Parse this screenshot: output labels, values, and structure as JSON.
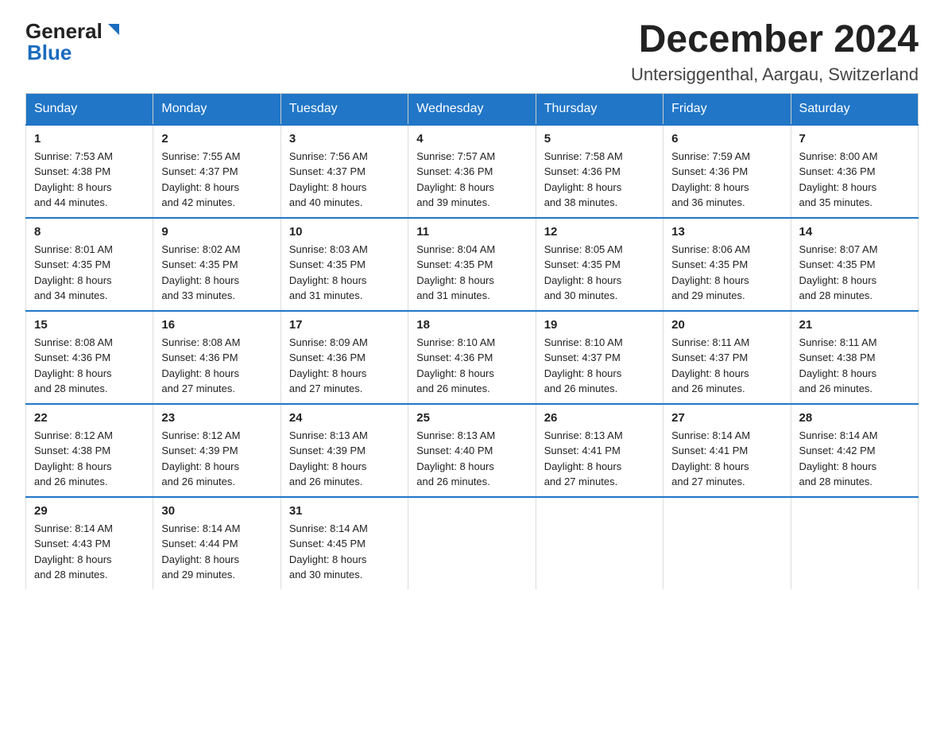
{
  "header": {
    "logo_general": "General",
    "logo_blue": "Blue",
    "title": "December 2024",
    "subtitle": "Untersiggenthal, Aargau, Switzerland"
  },
  "weekdays": [
    "Sunday",
    "Monday",
    "Tuesday",
    "Wednesday",
    "Thursday",
    "Friday",
    "Saturday"
  ],
  "weeks": [
    [
      {
        "day": "1",
        "sunrise": "Sunrise: 7:53 AM",
        "sunset": "Sunset: 4:38 PM",
        "daylight": "Daylight: 8 hours",
        "daylight2": "and 44 minutes."
      },
      {
        "day": "2",
        "sunrise": "Sunrise: 7:55 AM",
        "sunset": "Sunset: 4:37 PM",
        "daylight": "Daylight: 8 hours",
        "daylight2": "and 42 minutes."
      },
      {
        "day": "3",
        "sunrise": "Sunrise: 7:56 AM",
        "sunset": "Sunset: 4:37 PM",
        "daylight": "Daylight: 8 hours",
        "daylight2": "and 40 minutes."
      },
      {
        "day": "4",
        "sunrise": "Sunrise: 7:57 AM",
        "sunset": "Sunset: 4:36 PM",
        "daylight": "Daylight: 8 hours",
        "daylight2": "and 39 minutes."
      },
      {
        "day": "5",
        "sunrise": "Sunrise: 7:58 AM",
        "sunset": "Sunset: 4:36 PM",
        "daylight": "Daylight: 8 hours",
        "daylight2": "and 38 minutes."
      },
      {
        "day": "6",
        "sunrise": "Sunrise: 7:59 AM",
        "sunset": "Sunset: 4:36 PM",
        "daylight": "Daylight: 8 hours",
        "daylight2": "and 36 minutes."
      },
      {
        "day": "7",
        "sunrise": "Sunrise: 8:00 AM",
        "sunset": "Sunset: 4:36 PM",
        "daylight": "Daylight: 8 hours",
        "daylight2": "and 35 minutes."
      }
    ],
    [
      {
        "day": "8",
        "sunrise": "Sunrise: 8:01 AM",
        "sunset": "Sunset: 4:35 PM",
        "daylight": "Daylight: 8 hours",
        "daylight2": "and 34 minutes."
      },
      {
        "day": "9",
        "sunrise": "Sunrise: 8:02 AM",
        "sunset": "Sunset: 4:35 PM",
        "daylight": "Daylight: 8 hours",
        "daylight2": "and 33 minutes."
      },
      {
        "day": "10",
        "sunrise": "Sunrise: 8:03 AM",
        "sunset": "Sunset: 4:35 PM",
        "daylight": "Daylight: 8 hours",
        "daylight2": "and 31 minutes."
      },
      {
        "day": "11",
        "sunrise": "Sunrise: 8:04 AM",
        "sunset": "Sunset: 4:35 PM",
        "daylight": "Daylight: 8 hours",
        "daylight2": "and 31 minutes."
      },
      {
        "day": "12",
        "sunrise": "Sunrise: 8:05 AM",
        "sunset": "Sunset: 4:35 PM",
        "daylight": "Daylight: 8 hours",
        "daylight2": "and 30 minutes."
      },
      {
        "day": "13",
        "sunrise": "Sunrise: 8:06 AM",
        "sunset": "Sunset: 4:35 PM",
        "daylight": "Daylight: 8 hours",
        "daylight2": "and 29 minutes."
      },
      {
        "day": "14",
        "sunrise": "Sunrise: 8:07 AM",
        "sunset": "Sunset: 4:35 PM",
        "daylight": "Daylight: 8 hours",
        "daylight2": "and 28 minutes."
      }
    ],
    [
      {
        "day": "15",
        "sunrise": "Sunrise: 8:08 AM",
        "sunset": "Sunset: 4:36 PM",
        "daylight": "Daylight: 8 hours",
        "daylight2": "and 28 minutes."
      },
      {
        "day": "16",
        "sunrise": "Sunrise: 8:08 AM",
        "sunset": "Sunset: 4:36 PM",
        "daylight": "Daylight: 8 hours",
        "daylight2": "and 27 minutes."
      },
      {
        "day": "17",
        "sunrise": "Sunrise: 8:09 AM",
        "sunset": "Sunset: 4:36 PM",
        "daylight": "Daylight: 8 hours",
        "daylight2": "and 27 minutes."
      },
      {
        "day": "18",
        "sunrise": "Sunrise: 8:10 AM",
        "sunset": "Sunset: 4:36 PM",
        "daylight": "Daylight: 8 hours",
        "daylight2": "and 26 minutes."
      },
      {
        "day": "19",
        "sunrise": "Sunrise: 8:10 AM",
        "sunset": "Sunset: 4:37 PM",
        "daylight": "Daylight: 8 hours",
        "daylight2": "and 26 minutes."
      },
      {
        "day": "20",
        "sunrise": "Sunrise: 8:11 AM",
        "sunset": "Sunset: 4:37 PM",
        "daylight": "Daylight: 8 hours",
        "daylight2": "and 26 minutes."
      },
      {
        "day": "21",
        "sunrise": "Sunrise: 8:11 AM",
        "sunset": "Sunset: 4:38 PM",
        "daylight": "Daylight: 8 hours",
        "daylight2": "and 26 minutes."
      }
    ],
    [
      {
        "day": "22",
        "sunrise": "Sunrise: 8:12 AM",
        "sunset": "Sunset: 4:38 PM",
        "daylight": "Daylight: 8 hours",
        "daylight2": "and 26 minutes."
      },
      {
        "day": "23",
        "sunrise": "Sunrise: 8:12 AM",
        "sunset": "Sunset: 4:39 PM",
        "daylight": "Daylight: 8 hours",
        "daylight2": "and 26 minutes."
      },
      {
        "day": "24",
        "sunrise": "Sunrise: 8:13 AM",
        "sunset": "Sunset: 4:39 PM",
        "daylight": "Daylight: 8 hours",
        "daylight2": "and 26 minutes."
      },
      {
        "day": "25",
        "sunrise": "Sunrise: 8:13 AM",
        "sunset": "Sunset: 4:40 PM",
        "daylight": "Daylight: 8 hours",
        "daylight2": "and 26 minutes."
      },
      {
        "day": "26",
        "sunrise": "Sunrise: 8:13 AM",
        "sunset": "Sunset: 4:41 PM",
        "daylight": "Daylight: 8 hours",
        "daylight2": "and 27 minutes."
      },
      {
        "day": "27",
        "sunrise": "Sunrise: 8:14 AM",
        "sunset": "Sunset: 4:41 PM",
        "daylight": "Daylight: 8 hours",
        "daylight2": "and 27 minutes."
      },
      {
        "day": "28",
        "sunrise": "Sunrise: 8:14 AM",
        "sunset": "Sunset: 4:42 PM",
        "daylight": "Daylight: 8 hours",
        "daylight2": "and 28 minutes."
      }
    ],
    [
      {
        "day": "29",
        "sunrise": "Sunrise: 8:14 AM",
        "sunset": "Sunset: 4:43 PM",
        "daylight": "Daylight: 8 hours",
        "daylight2": "and 28 minutes."
      },
      {
        "day": "30",
        "sunrise": "Sunrise: 8:14 AM",
        "sunset": "Sunset: 4:44 PM",
        "daylight": "Daylight: 8 hours",
        "daylight2": "and 29 minutes."
      },
      {
        "day": "31",
        "sunrise": "Sunrise: 8:14 AM",
        "sunset": "Sunset: 4:45 PM",
        "daylight": "Daylight: 8 hours",
        "daylight2": "and 30 minutes."
      },
      null,
      null,
      null,
      null
    ]
  ]
}
